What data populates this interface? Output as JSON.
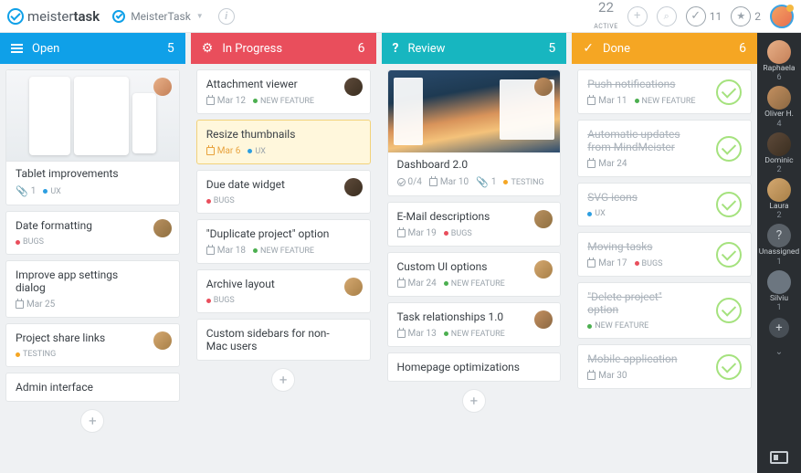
{
  "header": {
    "logo_light": "meister",
    "logo_bold": "task",
    "project_name": "MeisterTask",
    "active_count": "22",
    "active_label": "ACTIVE",
    "done_count": "11",
    "star_count": "2"
  },
  "columns": [
    {
      "title": "Open",
      "count": "5",
      "color": "c-blue"
    },
    {
      "title": "In Progress",
      "count": "6",
      "color": "c-red"
    },
    {
      "title": "Review",
      "count": "5",
      "color": "c-teal"
    },
    {
      "title": "Done",
      "count": "6",
      "color": "c-orange"
    }
  ],
  "tags": {
    "new_feature": "NEW FEATURE",
    "bugs": "BUGS",
    "ux": "UX",
    "testing": "TESTING"
  },
  "open": [
    {
      "title": "Tablet improvements",
      "attach": "1",
      "tag": "ux"
    },
    {
      "title": "Date formatting",
      "tag": "bugs"
    },
    {
      "title": "Improve app settings dialog",
      "date": "Mar 25"
    },
    {
      "title": "Project share links",
      "tag": "testing"
    },
    {
      "title": "Admin interface"
    }
  ],
  "progress": [
    {
      "title": "Attachment viewer",
      "date": "Mar 12",
      "tag": "new_feature"
    },
    {
      "title": "Resize thumbnails",
      "date": "Mar 6",
      "tag": "ux",
      "hl": true
    },
    {
      "title": "Due date widget",
      "tag": "bugs"
    },
    {
      "title": "\"Duplicate project\" option",
      "date": "Mar 18",
      "tag": "new_feature"
    },
    {
      "title": "Archive layout",
      "tag": "bugs"
    },
    {
      "title": "Custom sidebars for non-Mac users"
    }
  ],
  "review": [
    {
      "title": "Dashboard 2.0",
      "checks": "0/4",
      "date": "Mar 10",
      "attach": "1",
      "tag": "testing"
    },
    {
      "title": "E-Mail descriptions",
      "date": "Mar 19",
      "tag": "bugs"
    },
    {
      "title": "Custom UI options",
      "date": "Mar 24",
      "tag": "new_feature"
    },
    {
      "title": "Task relationships 1.0",
      "date": "Mar 13",
      "tag": "new_feature"
    },
    {
      "title": "Homepage optimizations"
    }
  ],
  "done": [
    {
      "title": "Push notifications",
      "date": "Mar 11",
      "tag": "new_feature"
    },
    {
      "title": "Automatic updates from MindMeister",
      "date": "Mar 24"
    },
    {
      "title": "SVG icons",
      "tag": "ux"
    },
    {
      "title": "Moving tasks",
      "date": "Mar 17",
      "tag": "bugs"
    },
    {
      "title": "\"Delete project\" option",
      "tag": "new_feature"
    },
    {
      "title": "Mobile application",
      "date": "Mar 30"
    }
  ],
  "sidebar": [
    {
      "name": "Raphaela",
      "count": "6",
      "av": "av2"
    },
    {
      "name": "Oliver H.",
      "count": "4",
      "av": "av1"
    },
    {
      "name": "Dominic",
      "count": "2",
      "av": "av3"
    },
    {
      "name": "Laura",
      "count": "2",
      "av": "av4"
    },
    {
      "name": "Unassigned",
      "count": "1",
      "q": true
    },
    {
      "name": "Silviu",
      "count": "1",
      "av": "av6"
    }
  ]
}
